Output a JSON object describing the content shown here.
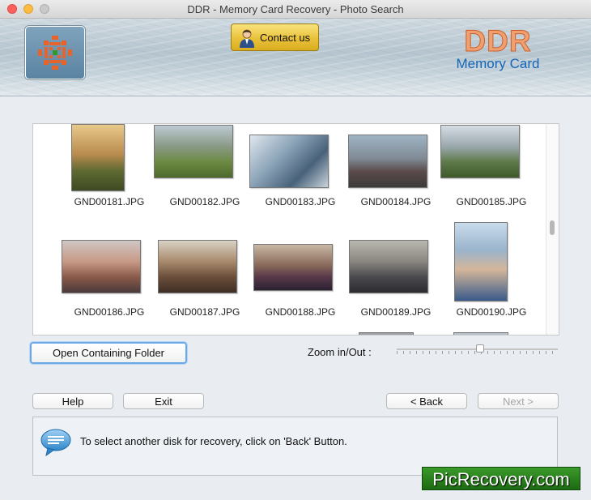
{
  "window": {
    "title": "DDR - Memory Card Recovery - Photo Search"
  },
  "header": {
    "contact_label": "Contact us",
    "brand_name": "DDR",
    "brand_product": "Memory Card"
  },
  "gallery": {
    "items": [
      {
        "filename": "GND00181.JPG",
        "thumb_color": "#8f8a5a"
      },
      {
        "filename": "GND00182.JPG",
        "thumb_color": "#6f8f56"
      },
      {
        "filename": "GND00183.JPG",
        "thumb_color": "#7e95a8"
      },
      {
        "filename": "GND00184.JPG",
        "thumb_color": "#6e7c8c"
      },
      {
        "filename": "GND00185.JPG",
        "thumb_color": "#6e8b5c"
      },
      {
        "filename": "GND00186.JPG",
        "thumb_color": "#b79586"
      },
      {
        "filename": "GND00187.JPG",
        "thumb_color": "#9b7c60"
      },
      {
        "filename": "GND00188.JPG",
        "thumb_color": "#7a6a6e"
      },
      {
        "filename": "GND00189.JPG",
        "thumb_color": "#6d6a68"
      },
      {
        "filename": "GND00190.JPG",
        "thumb_color": "#8aa0b4"
      }
    ]
  },
  "buttons": {
    "open_folder": "Open Containing Folder",
    "help": "Help",
    "exit": "Exit",
    "back": "< Back",
    "next": "Next >"
  },
  "zoom": {
    "label": "Zoom in/Out :",
    "level": 0.52
  },
  "info": {
    "message": "To select another disk for recovery, click on 'Back' Button."
  },
  "watermark": "PicRecovery.com"
}
